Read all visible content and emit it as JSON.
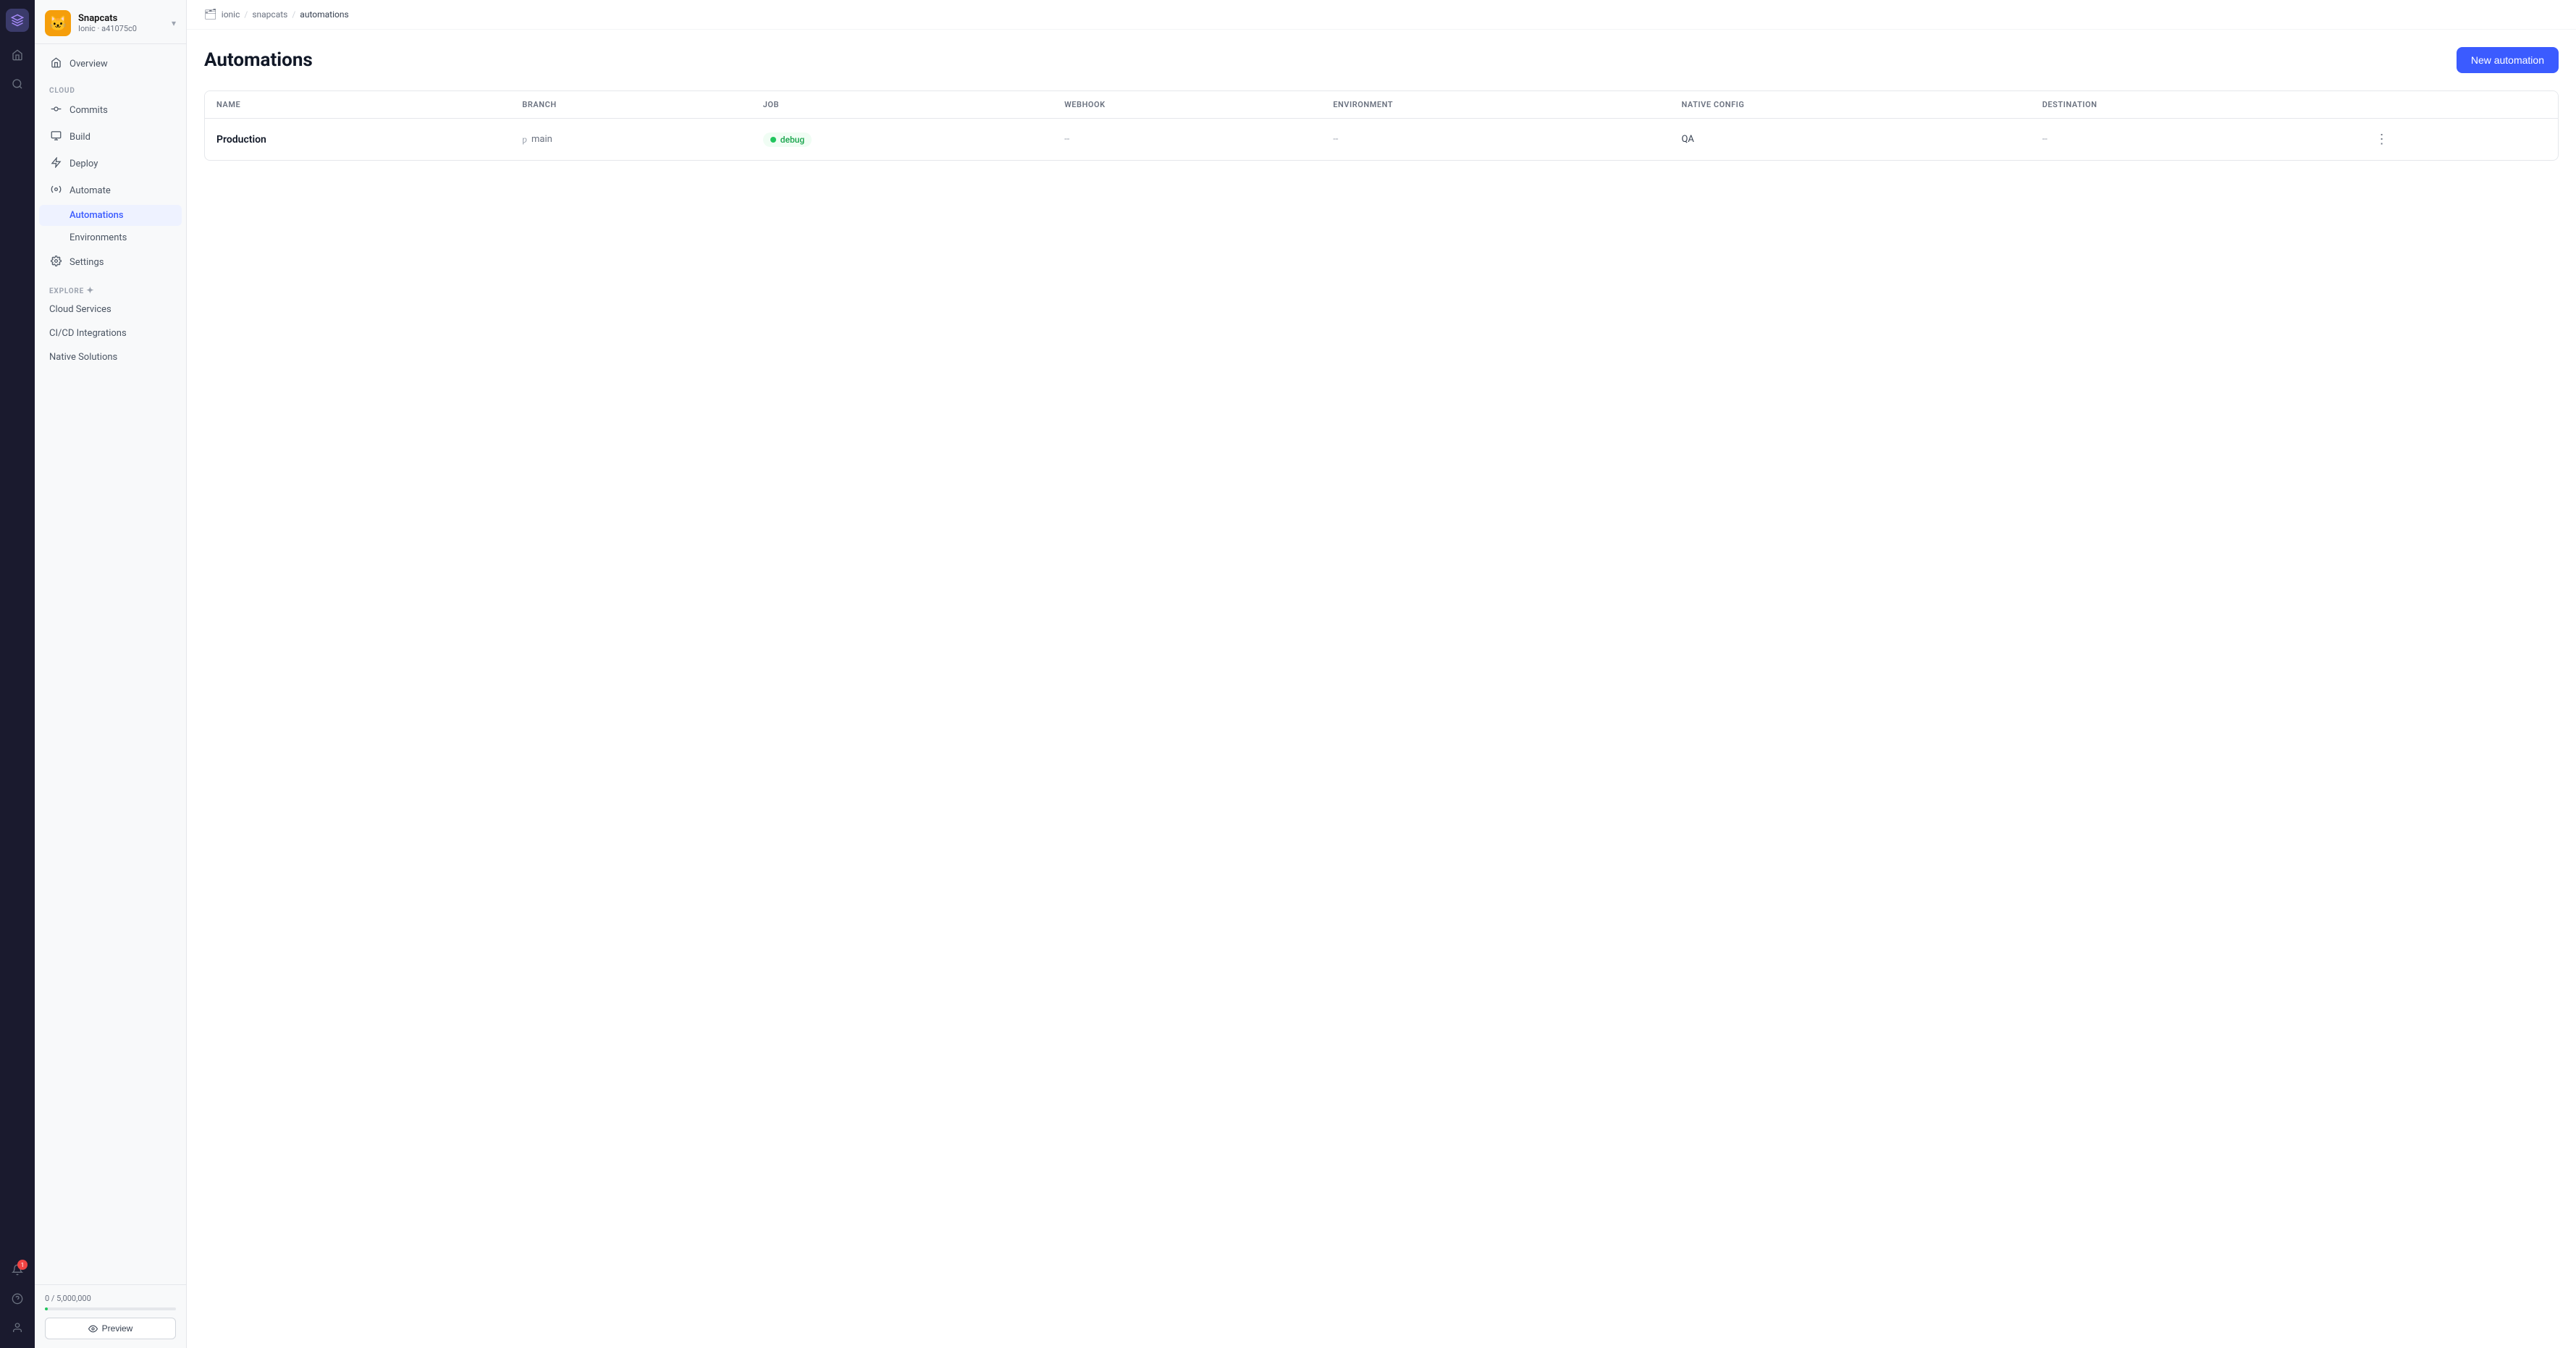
{
  "app": {
    "name": "Snapcats",
    "sub": "Ionic · a41075c0",
    "logo_emoji": "🐱"
  },
  "iconbar": {
    "logo_label": "Snapcats logo",
    "search_label": "Search",
    "notification_count": "1"
  },
  "breadcrumb": {
    "icon": "🗂",
    "org": "ionic",
    "repo": "snapcats",
    "current": "automations"
  },
  "page": {
    "title": "Automations",
    "new_button": "New automation"
  },
  "sidebar": {
    "section_cloud": "CLOUD",
    "section_explore": "EXPLORE",
    "overview_label": "Overview",
    "commits_label": "Commits",
    "build_label": "Build",
    "deploy_label": "Deploy",
    "automate_label": "Automate",
    "automations_label": "Automations",
    "environments_label": "Environments",
    "settings_label": "Settings",
    "cloud_services_label": "Cloud Services",
    "cicd_label": "CI/CD Integrations",
    "native_label": "Native Solutions",
    "usage_label": "0 / 5,000,000",
    "preview_label": "Preview"
  },
  "table": {
    "columns": [
      "NAME",
      "BRANCH",
      "JOB",
      "WEBHOOK",
      "ENVIRONMENT",
      "NATIVE CONFIG",
      "DESTINATION"
    ],
    "rows": [
      {
        "name": "Production",
        "branch": "main",
        "branch_icon": "ƿ",
        "job": "debug",
        "job_status": "active",
        "webhook": "--",
        "environment": "--",
        "native_config": "QA",
        "destination": "--"
      }
    ]
  }
}
